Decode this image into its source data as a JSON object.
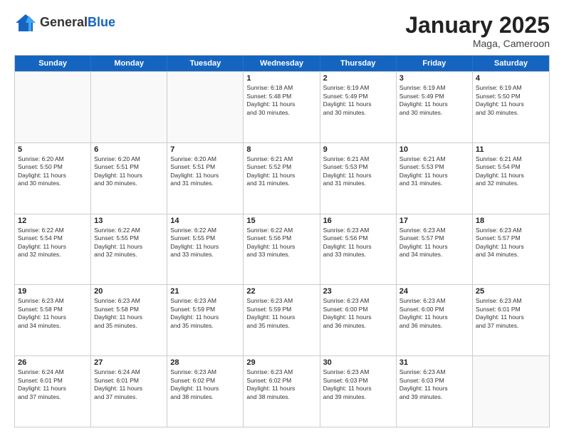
{
  "header": {
    "logo_general": "General",
    "logo_blue": "Blue",
    "month_title": "January 2025",
    "location": "Maga, Cameroon"
  },
  "weekdays": [
    "Sunday",
    "Monday",
    "Tuesday",
    "Wednesday",
    "Thursday",
    "Friday",
    "Saturday"
  ],
  "rows": [
    [
      {
        "day": "",
        "info": ""
      },
      {
        "day": "",
        "info": ""
      },
      {
        "day": "",
        "info": ""
      },
      {
        "day": "1",
        "info": "Sunrise: 6:18 AM\nSunset: 5:48 PM\nDaylight: 11 hours\nand 30 minutes."
      },
      {
        "day": "2",
        "info": "Sunrise: 6:19 AM\nSunset: 5:49 PM\nDaylight: 11 hours\nand 30 minutes."
      },
      {
        "day": "3",
        "info": "Sunrise: 6:19 AM\nSunset: 5:49 PM\nDaylight: 11 hours\nand 30 minutes."
      },
      {
        "day": "4",
        "info": "Sunrise: 6:19 AM\nSunset: 5:50 PM\nDaylight: 11 hours\nand 30 minutes."
      }
    ],
    [
      {
        "day": "5",
        "info": "Sunrise: 6:20 AM\nSunset: 5:50 PM\nDaylight: 11 hours\nand 30 minutes."
      },
      {
        "day": "6",
        "info": "Sunrise: 6:20 AM\nSunset: 5:51 PM\nDaylight: 11 hours\nand 30 minutes."
      },
      {
        "day": "7",
        "info": "Sunrise: 6:20 AM\nSunset: 5:51 PM\nDaylight: 11 hours\nand 31 minutes."
      },
      {
        "day": "8",
        "info": "Sunrise: 6:21 AM\nSunset: 5:52 PM\nDaylight: 11 hours\nand 31 minutes."
      },
      {
        "day": "9",
        "info": "Sunrise: 6:21 AM\nSunset: 5:53 PM\nDaylight: 11 hours\nand 31 minutes."
      },
      {
        "day": "10",
        "info": "Sunrise: 6:21 AM\nSunset: 5:53 PM\nDaylight: 11 hours\nand 31 minutes."
      },
      {
        "day": "11",
        "info": "Sunrise: 6:21 AM\nSunset: 5:54 PM\nDaylight: 11 hours\nand 32 minutes."
      }
    ],
    [
      {
        "day": "12",
        "info": "Sunrise: 6:22 AM\nSunset: 5:54 PM\nDaylight: 11 hours\nand 32 minutes."
      },
      {
        "day": "13",
        "info": "Sunrise: 6:22 AM\nSunset: 5:55 PM\nDaylight: 11 hours\nand 32 minutes."
      },
      {
        "day": "14",
        "info": "Sunrise: 6:22 AM\nSunset: 5:55 PM\nDaylight: 11 hours\nand 33 minutes."
      },
      {
        "day": "15",
        "info": "Sunrise: 6:22 AM\nSunset: 5:56 PM\nDaylight: 11 hours\nand 33 minutes."
      },
      {
        "day": "16",
        "info": "Sunrise: 6:23 AM\nSunset: 5:56 PM\nDaylight: 11 hours\nand 33 minutes."
      },
      {
        "day": "17",
        "info": "Sunrise: 6:23 AM\nSunset: 5:57 PM\nDaylight: 11 hours\nand 34 minutes."
      },
      {
        "day": "18",
        "info": "Sunrise: 6:23 AM\nSunset: 5:57 PM\nDaylight: 11 hours\nand 34 minutes."
      }
    ],
    [
      {
        "day": "19",
        "info": "Sunrise: 6:23 AM\nSunset: 5:58 PM\nDaylight: 11 hours\nand 34 minutes."
      },
      {
        "day": "20",
        "info": "Sunrise: 6:23 AM\nSunset: 5:58 PM\nDaylight: 11 hours\nand 35 minutes."
      },
      {
        "day": "21",
        "info": "Sunrise: 6:23 AM\nSunset: 5:59 PM\nDaylight: 11 hours\nand 35 minutes."
      },
      {
        "day": "22",
        "info": "Sunrise: 6:23 AM\nSunset: 5:59 PM\nDaylight: 11 hours\nand 35 minutes."
      },
      {
        "day": "23",
        "info": "Sunrise: 6:23 AM\nSunset: 6:00 PM\nDaylight: 11 hours\nand 36 minutes."
      },
      {
        "day": "24",
        "info": "Sunrise: 6:23 AM\nSunset: 6:00 PM\nDaylight: 11 hours\nand 36 minutes."
      },
      {
        "day": "25",
        "info": "Sunrise: 6:23 AM\nSunset: 6:01 PM\nDaylight: 11 hours\nand 37 minutes."
      }
    ],
    [
      {
        "day": "26",
        "info": "Sunrise: 6:24 AM\nSunset: 6:01 PM\nDaylight: 11 hours\nand 37 minutes."
      },
      {
        "day": "27",
        "info": "Sunrise: 6:24 AM\nSunset: 6:01 PM\nDaylight: 11 hours\nand 37 minutes."
      },
      {
        "day": "28",
        "info": "Sunrise: 6:23 AM\nSunset: 6:02 PM\nDaylight: 11 hours\nand 38 minutes."
      },
      {
        "day": "29",
        "info": "Sunrise: 6:23 AM\nSunset: 6:02 PM\nDaylight: 11 hours\nand 38 minutes."
      },
      {
        "day": "30",
        "info": "Sunrise: 6:23 AM\nSunset: 6:03 PM\nDaylight: 11 hours\nand 39 minutes."
      },
      {
        "day": "31",
        "info": "Sunrise: 6:23 AM\nSunset: 6:03 PM\nDaylight: 11 hours\nand 39 minutes."
      },
      {
        "day": "",
        "info": ""
      }
    ]
  ]
}
